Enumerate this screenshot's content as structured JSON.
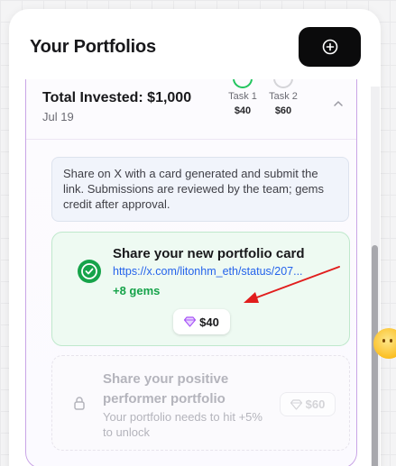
{
  "panel": {
    "title": "Your Portfolios",
    "add_icon": "plus-circle-icon"
  },
  "portfolio": {
    "total_label": "Total Invested: $1,000",
    "date": "Jul 19",
    "tasks": [
      {
        "name": "Task 1",
        "amount": "$40",
        "status": "completed",
        "color": "#22c55e"
      },
      {
        "name": "Task 2",
        "amount": "$60",
        "status": "pending",
        "color": "#d4d4d8"
      }
    ],
    "collapse_icon": "chevron-up-icon",
    "info_text": "Share on X with a card generated and submit the link. Submissions are reviewed by the team; gems credit after approval.",
    "task_card": {
      "title": "Share your new portfolio card",
      "link": "https://x.com/litonhm_eth/status/207...",
      "gems": "+8 gems",
      "amount": "$40",
      "icon": "check-circle-icon",
      "gem_icon": "gem-icon",
      "accent": "#16a34a"
    },
    "locked_card": {
      "title": "Share your positive performer portfolio",
      "description": "Your portfolio needs to hit +5% to unlock",
      "amount": "$60",
      "icon": "lock-icon",
      "gem_icon": "gem-icon"
    }
  },
  "annotation": {
    "arrow_color": "#e11d1d"
  },
  "brand": {
    "border": "#c9a5e6",
    "gem": "#a855f7"
  }
}
